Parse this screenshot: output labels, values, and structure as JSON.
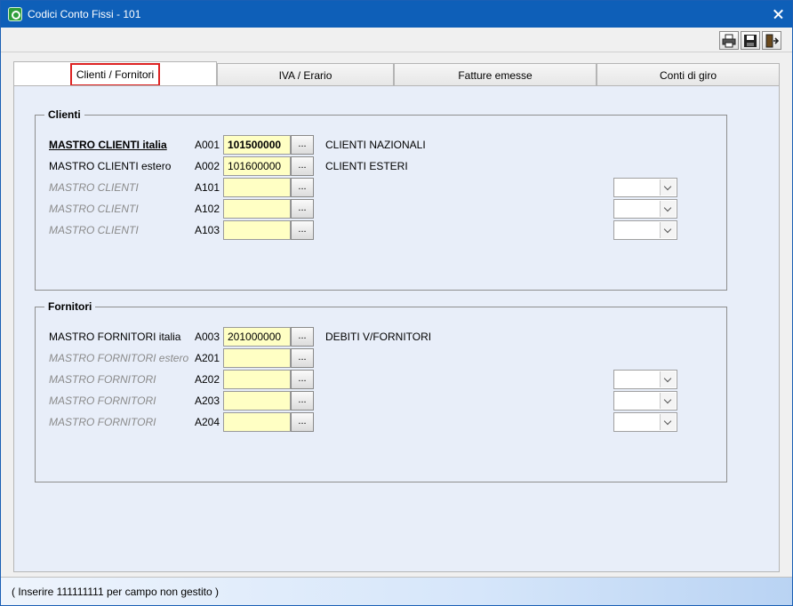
{
  "window": {
    "title": "Codici Conto Fissi - 101"
  },
  "toolbar": {
    "print_icon": "printer-icon",
    "save_icon": "floppy-disk-icon",
    "exit_icon": "exit-door-icon"
  },
  "tabs": [
    {
      "label": "Clienti / Fornitori",
      "active": true
    },
    {
      "label": "IVA / Erario",
      "active": false
    },
    {
      "label": "Fatture emesse",
      "active": false
    },
    {
      "label": "Conti di giro",
      "active": false
    }
  ],
  "clienti": {
    "legend": "Clienti",
    "rows": [
      {
        "label": "MASTRO CLIENTI italia",
        "code": "A001",
        "value": "101500000",
        "lookup": "...",
        "description": "CLIENTI NAZIONALI"
      },
      {
        "label": "MASTRO CLIENTI estero",
        "code": "A002",
        "value": "101600000",
        "lookup": "...",
        "description": "CLIENTI ESTERI"
      },
      {
        "label": "MASTRO CLIENTI",
        "code": "A101",
        "value": "",
        "lookup": "...",
        "description": ""
      },
      {
        "label": "MASTRO CLIENTI",
        "code": "A102",
        "value": "",
        "lookup": "...",
        "description": ""
      },
      {
        "label": "MASTRO CLIENTI",
        "code": "A103",
        "value": "",
        "lookup": "...",
        "description": ""
      }
    ]
  },
  "fornitori": {
    "legend": "Fornitori",
    "rows": [
      {
        "label": "MASTRO FORNITORI italia",
        "code": "A003",
        "value": "201000000",
        "lookup": "...",
        "description": "DEBITI V/FORNITORI"
      },
      {
        "label": "MASTRO FORNITORI estero",
        "code": "A201",
        "value": "",
        "lookup": "...",
        "description": ""
      },
      {
        "label": "MASTRO FORNITORI",
        "code": "A202",
        "value": "",
        "lookup": "...",
        "description": ""
      },
      {
        "label": "MASTRO FORNITORI",
        "code": "A203",
        "value": "",
        "lookup": "...",
        "description": ""
      },
      {
        "label": "MASTRO FORNITORI",
        "code": "A204",
        "value": "",
        "lookup": "...",
        "description": ""
      }
    ]
  },
  "status": {
    "text": "( Inserire 111111111 per campo non gestito )"
  },
  "colors": {
    "titlebar": "#0e5fb8",
    "field_bg": "#ffffc4",
    "panel_bg": "#e8eef9",
    "tab_highlight": "#dd2222"
  }
}
